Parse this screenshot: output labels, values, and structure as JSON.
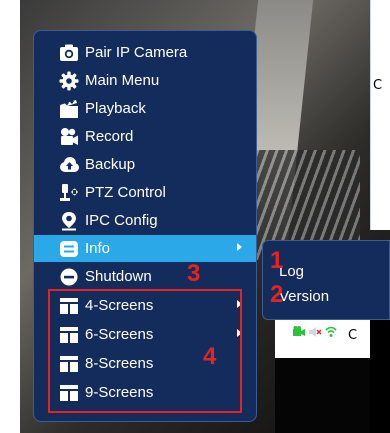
{
  "menu": {
    "items": [
      {
        "label": "Pair IP Camera",
        "icon": "camera-icon"
      },
      {
        "label": "Main Menu",
        "icon": "gear-icon"
      },
      {
        "label": "Playback",
        "icon": "clapperboard-icon"
      },
      {
        "label": "Record",
        "icon": "record-camera-icon"
      },
      {
        "label": "Backup",
        "icon": "cloud-icon"
      },
      {
        "label": "PTZ Control",
        "icon": "ptz-icon"
      },
      {
        "label": "IPC Config",
        "icon": "location-pin-icon"
      },
      {
        "label": "Info",
        "icon": "info-icon",
        "active": true,
        "has_submenu": true
      },
      {
        "label": "Shutdown",
        "icon": "minus-circle-icon"
      },
      {
        "label": "4-Screens",
        "icon": "grid-icon",
        "has_submenu": true
      },
      {
        "label": "6-Screens",
        "icon": "grid-icon",
        "has_submenu": true
      },
      {
        "label": "8-Screens",
        "icon": "grid-icon"
      },
      {
        "label": "9-Screens",
        "icon": "grid-icon"
      }
    ]
  },
  "submenu": {
    "items": [
      {
        "label": "Log"
      },
      {
        "label": "Version"
      }
    ]
  },
  "annotations": {
    "n1": "1",
    "n2": "2",
    "n3": "3",
    "n4": "4"
  },
  "panes": {
    "top_right_letter": "C",
    "bottom_right_letter": "C"
  },
  "colors": {
    "menu_bg": "#142c5c",
    "active_bg": "#2aa8e8",
    "annotation_red": "#e8231f"
  }
}
